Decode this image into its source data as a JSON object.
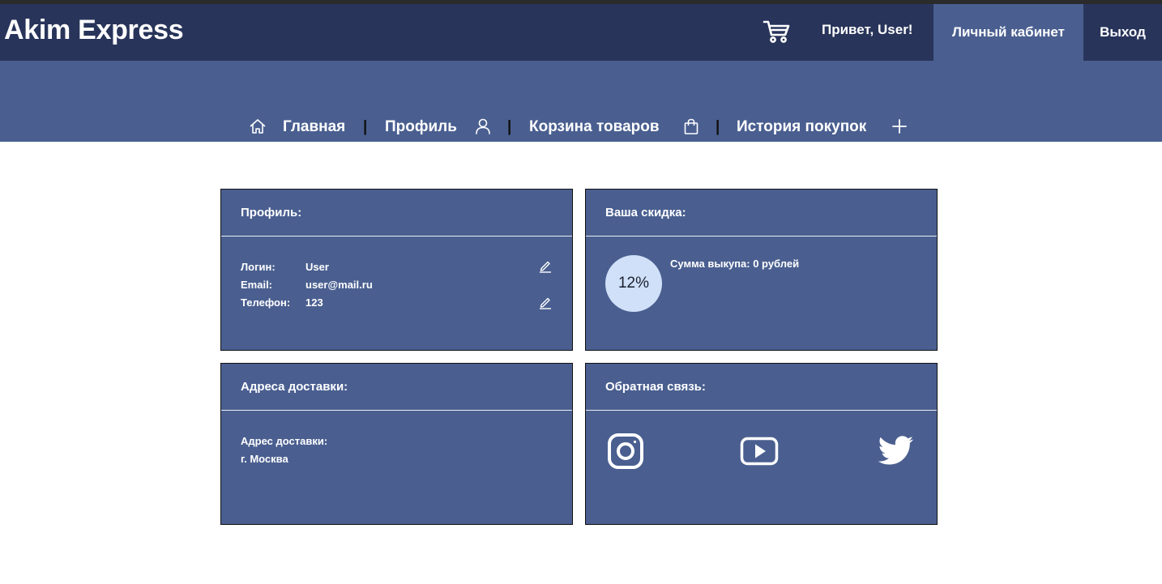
{
  "header": {
    "brand": "Akim Express",
    "cart_icon": "shopping-cart-icon",
    "greeting": "Привет, User!",
    "cabinet_label": "Личный кабинет",
    "logout_label": "Выход"
  },
  "nav": {
    "items": [
      {
        "label": "Главная",
        "icon": "home-icon"
      },
      {
        "label": "Профиль",
        "icon": "user-icon"
      },
      {
        "label": "Корзина товаров",
        "icon": "shopping-bag-icon"
      },
      {
        "label": "История покупок",
        "icon": "plus-icon"
      }
    ],
    "separator": "|"
  },
  "profile": {
    "title": "Профиль:",
    "rows": [
      {
        "label": "Логин:",
        "value": "User"
      },
      {
        "label": "Email:",
        "value": "user@mail.ru"
      },
      {
        "label": "Телефон:",
        "value": "123"
      }
    ]
  },
  "discount": {
    "title": "Ваша скидка:",
    "percent": "12%",
    "sum_text": "Сумма выкупа: 0 рублей"
  },
  "delivery": {
    "title": "Адреса доставки:",
    "label": "Адрес доставки:",
    "value": "г. Москва"
  },
  "feedback": {
    "title": "Обратная связь:",
    "icons": [
      "instagram-icon",
      "youtube-icon",
      "twitter-icon"
    ]
  },
  "colors": {
    "header_dark": "#28345a",
    "accent_blue": "#4a5f90",
    "circle_light": "#cfe0f8"
  }
}
